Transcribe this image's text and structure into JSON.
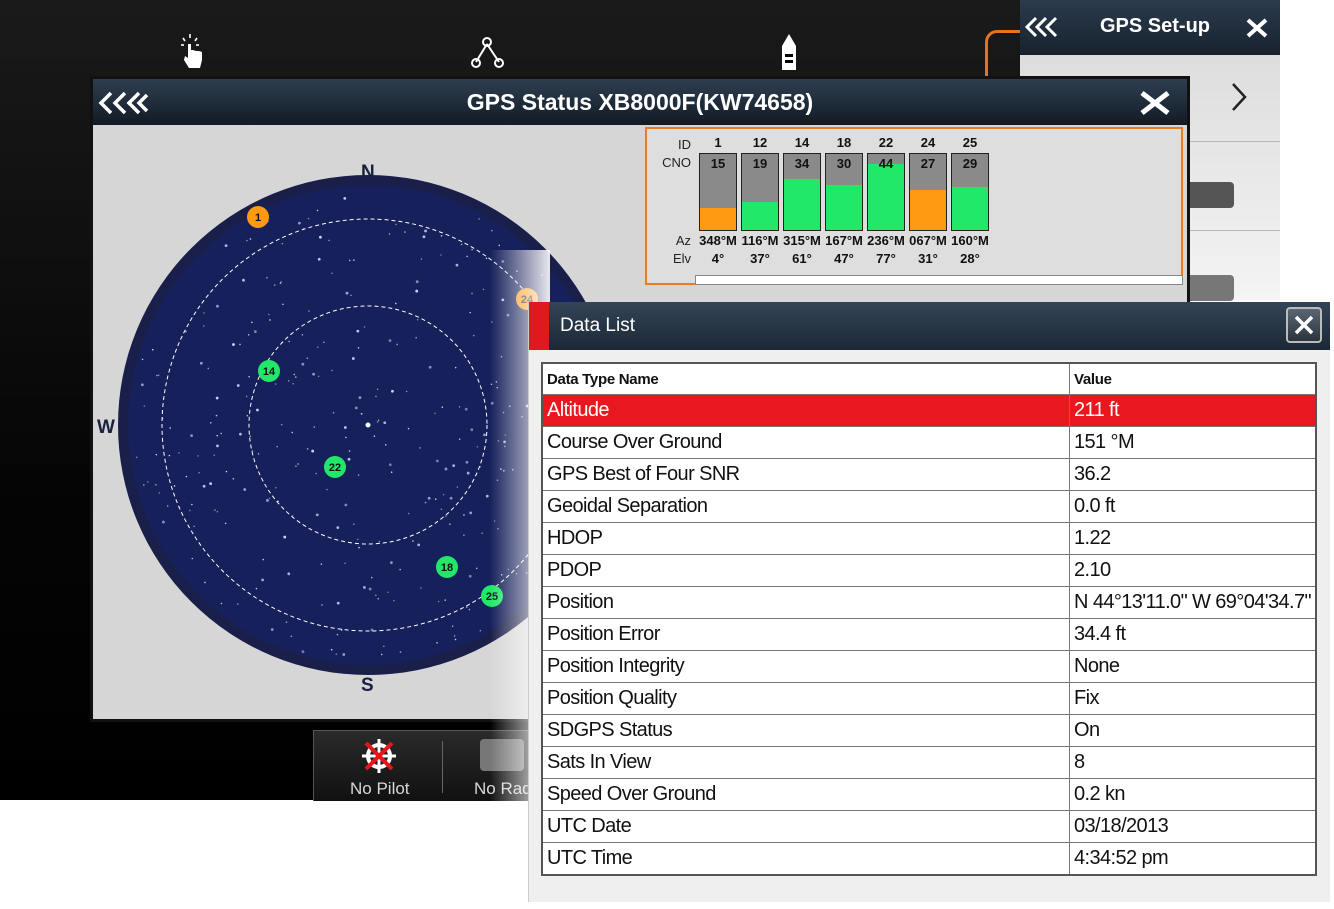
{
  "toolbar_icons": [
    "touch-icon",
    "route-icon",
    "boat-icon"
  ],
  "colors": {
    "header_dark": "#1b2836",
    "accent_orange": "#e97d22",
    "selected_red": "#e9181e",
    "signal_green": "#22e86a",
    "signal_orange": "#ff9a10",
    "sky_navy": "#16205a"
  },
  "gps_setup": {
    "title": "GPS Set-up"
  },
  "bottom_bar": {
    "pilot_label": "No Pilot",
    "radar_label": "No Rad"
  },
  "gps_status": {
    "title": "GPS Status XB8000F(KW74658)",
    "compass": {
      "n": "N",
      "s": "S",
      "w": "W"
    },
    "sky_satellites": [
      {
        "id": "1",
        "status": "orange"
      },
      {
        "id": "14",
        "status": "green"
      },
      {
        "id": "22",
        "status": "green"
      },
      {
        "id": "18",
        "status": "green"
      },
      {
        "id": "25",
        "status": "green"
      },
      {
        "id": "24",
        "status": "orange"
      }
    ],
    "signal": {
      "labels": {
        "id": "ID",
        "cno": "CNO",
        "az": "Az",
        "elv": "Elv"
      },
      "satellites": [
        {
          "id": "1",
          "cno": "15",
          "level": 0.29,
          "status": "orange",
          "az": "348°M",
          "elv": "4°"
        },
        {
          "id": "12",
          "cno": "19",
          "level": 0.37,
          "status": "green",
          "az": "116°M",
          "elv": "37°"
        },
        {
          "id": "14",
          "cno": "34",
          "level": 0.67,
          "status": "green",
          "az": "315°M",
          "elv": "61°"
        },
        {
          "id": "18",
          "cno": "30",
          "level": 0.59,
          "status": "green",
          "az": "167°M",
          "elv": "47°"
        },
        {
          "id": "22",
          "cno": "44",
          "level": 0.87,
          "status": "green",
          "az": "236°M",
          "elv": "77°"
        },
        {
          "id": "24",
          "cno": "27",
          "level": 0.53,
          "status": "orange",
          "az": "067°M",
          "elv": "31°"
        },
        {
          "id": "25",
          "cno": "29",
          "level": 0.57,
          "status": "green",
          "az": "160°M",
          "elv": "28°"
        }
      ]
    }
  },
  "data_list": {
    "title": "Data List",
    "columns": [
      "Data Type Name",
      "Value"
    ],
    "selected_row": 0,
    "rows": [
      {
        "name": "Altitude",
        "value": "211 ft"
      },
      {
        "name": "Course Over Ground",
        "value": "151 °M"
      },
      {
        "name": "GPS Best of Four SNR",
        "value": "36.2"
      },
      {
        "name": "Geoidal Separation",
        "value": "0.0 ft"
      },
      {
        "name": "HDOP",
        "value": "1.22"
      },
      {
        "name": "PDOP",
        "value": "2.10"
      },
      {
        "name": "Position",
        "value": "N  44°13'11.0\" W  69°04'34.7\""
      },
      {
        "name": "Position Error",
        "value": "34.4 ft"
      },
      {
        "name": "Position Integrity",
        "value": "None"
      },
      {
        "name": "Position Quality",
        "value": "Fix"
      },
      {
        "name": "SDGPS Status",
        "value": "On"
      },
      {
        "name": "Sats In View",
        "value": "8"
      },
      {
        "name": "Speed Over Ground",
        "value": "0.2 kn"
      },
      {
        "name": "UTC Date",
        "value": "03/18/2013"
      },
      {
        "name": "UTC Time",
        "value": "4:34:52 pm"
      }
    ]
  }
}
